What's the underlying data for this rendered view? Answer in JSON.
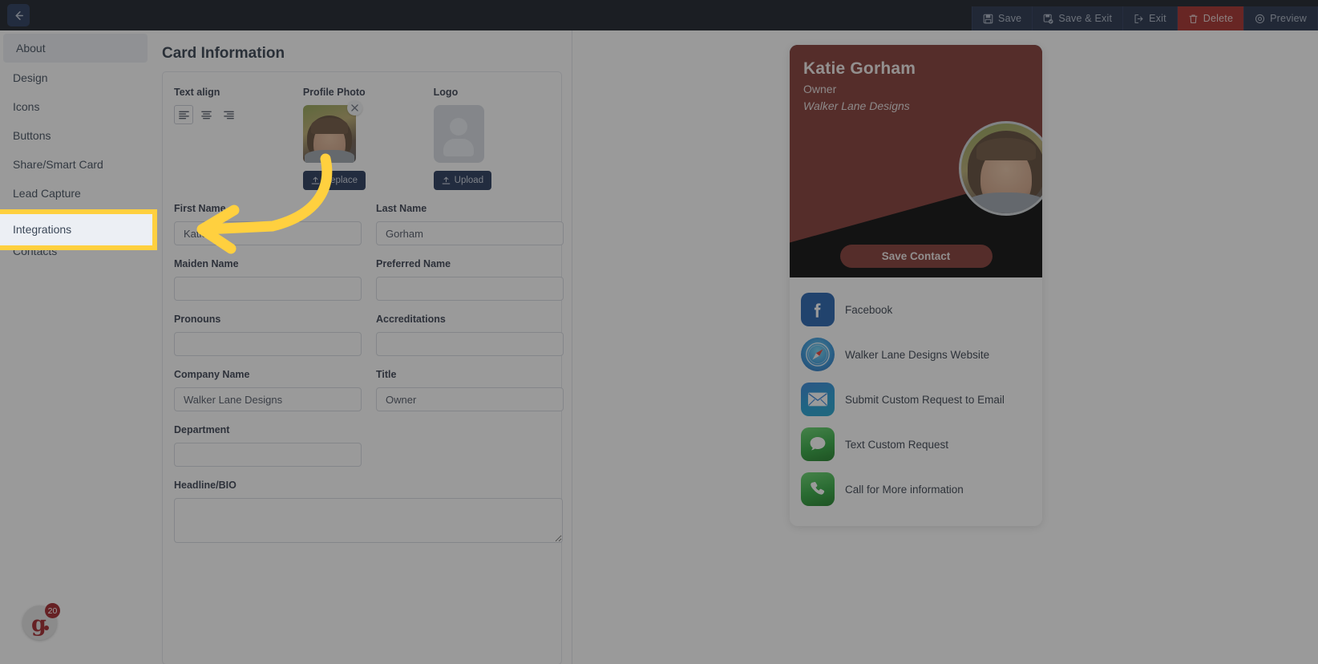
{
  "topbar": {
    "back_icon": "arrow-left-icon",
    "actions": [
      {
        "label": "Save",
        "icon": "floppy-disk-icon",
        "style": "default"
      },
      {
        "label": "Save & Exit",
        "icon": "floppy-disk-check-icon",
        "style": "default"
      },
      {
        "label": "Exit",
        "icon": "exit-arrow-icon",
        "style": "default"
      },
      {
        "label": "Delete",
        "icon": "trash-icon",
        "style": "danger"
      },
      {
        "label": "Preview",
        "icon": "eye-icon",
        "style": "default"
      }
    ]
  },
  "sidebar": {
    "items": [
      {
        "label": "About",
        "active": true
      },
      {
        "label": "Design",
        "active": false
      },
      {
        "label": "Icons",
        "active": false
      },
      {
        "label": "Buttons",
        "active": false
      },
      {
        "label": "Share/Smart Card",
        "active": false
      },
      {
        "label": "Lead Capture",
        "active": false
      },
      {
        "label": "Integrations",
        "active": false
      },
      {
        "label": "Contacts",
        "active": false
      }
    ],
    "logo": {
      "letter": "g",
      "badge_count": "20"
    }
  },
  "highlight": {
    "target_label": "Integrations",
    "border_color": "#ffd03f",
    "fill_color": "#eceff4"
  },
  "main": {
    "title": "Card Information",
    "text_align": {
      "label": "Text align",
      "options": [
        "align-left",
        "align-center",
        "align-right"
      ],
      "selected": "align-left"
    },
    "profile_photo": {
      "label": "Profile Photo",
      "button_label": "Replace",
      "has_image": true,
      "remove_icon": "close-icon"
    },
    "logo": {
      "label": "Logo",
      "button_label": "Upload",
      "has_image": false,
      "placeholder_icon": "person-avatar-icon"
    },
    "fields": [
      [
        {
          "label": "First Name",
          "value": "Katie",
          "placeholder": ""
        },
        {
          "label": "Last Name",
          "value": "Gorham",
          "placeholder": ""
        }
      ],
      [
        {
          "label": "Maiden Name",
          "value": "",
          "placeholder": ""
        },
        {
          "label": "Preferred Name",
          "value": "",
          "placeholder": ""
        }
      ],
      [
        {
          "label": "Pronouns",
          "value": "",
          "placeholder": ""
        },
        {
          "label": "Accreditations",
          "value": "",
          "placeholder": ""
        }
      ],
      [
        {
          "label": "Company Name",
          "value": "Walker Lane Designs",
          "placeholder": ""
        },
        {
          "label": "Title",
          "value": "Owner",
          "placeholder": ""
        }
      ],
      [
        {
          "label": "Department",
          "value": "",
          "placeholder": ""
        }
      ]
    ],
    "bio": {
      "label": "Headline/BIO",
      "value": "",
      "placeholder": ""
    }
  },
  "preview": {
    "name": "Katie Gorham",
    "role": "Owner",
    "company": "Walker Lane Designs",
    "save_contact_label": "Save Contact",
    "accent_color": "#7d312c",
    "secondary_color": "#000000",
    "links": [
      {
        "label": "Facebook",
        "icon": "facebook-icon",
        "color": "#1b5bab"
      },
      {
        "label": "Walker Lane Designs Website",
        "icon": "safari-compass-icon",
        "color": "#2a8fd8"
      },
      {
        "label": "Submit Custom Request to Email",
        "icon": "email-envelope-icon",
        "color": "#1a9ad4"
      },
      {
        "label": "Text Custom Request",
        "icon": "message-bubble-icon",
        "color": "#2aa63a"
      },
      {
        "label": "Call for More information",
        "icon": "phone-icon",
        "color": "#2aa63a"
      }
    ]
  }
}
